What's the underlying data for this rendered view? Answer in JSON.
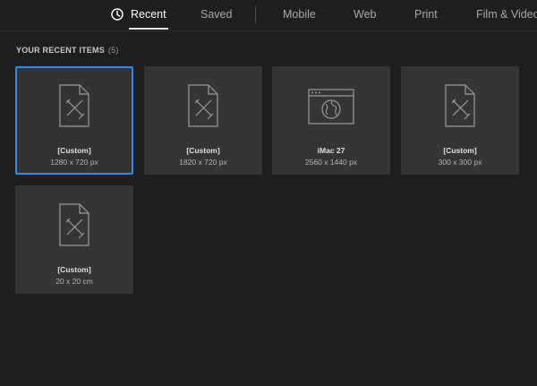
{
  "tabs": [
    {
      "label": "Recent",
      "icon": "clock-icon",
      "active": true
    },
    {
      "label": "Saved",
      "active": false
    },
    {
      "label": "Mobile",
      "active": false
    },
    {
      "label": "Web",
      "active": false
    },
    {
      "label": "Print",
      "active": false
    },
    {
      "label": "Film & Video",
      "active": false
    }
  ],
  "recent": {
    "title": "YOUR RECENT ITEMS",
    "count": "(5)",
    "items": [
      {
        "name": "[Custom]",
        "size": "1280 x 720 px",
        "icon": "custom-document-icon",
        "selected": true
      },
      {
        "name": "[Custom]",
        "size": "1820 x 720 px",
        "icon": "custom-document-icon",
        "selected": false
      },
      {
        "name": "iMac 27",
        "size": "2560 x 1440 px",
        "icon": "web-browser-globe-icon",
        "selected": false
      },
      {
        "name": "[Custom]",
        "size": "300 x 300 px",
        "icon": "custom-document-icon",
        "selected": false
      },
      {
        "name": "[Custom]",
        "size": "20 x 20 cm",
        "icon": "custom-document-icon",
        "selected": false
      }
    ]
  },
  "colors": {
    "background": "#1e1e1e",
    "card": "#353535",
    "selection": "#2d8ceb",
    "active_tab_text": "#ffffff",
    "inactive_tab_text": "#a8a8a8"
  }
}
